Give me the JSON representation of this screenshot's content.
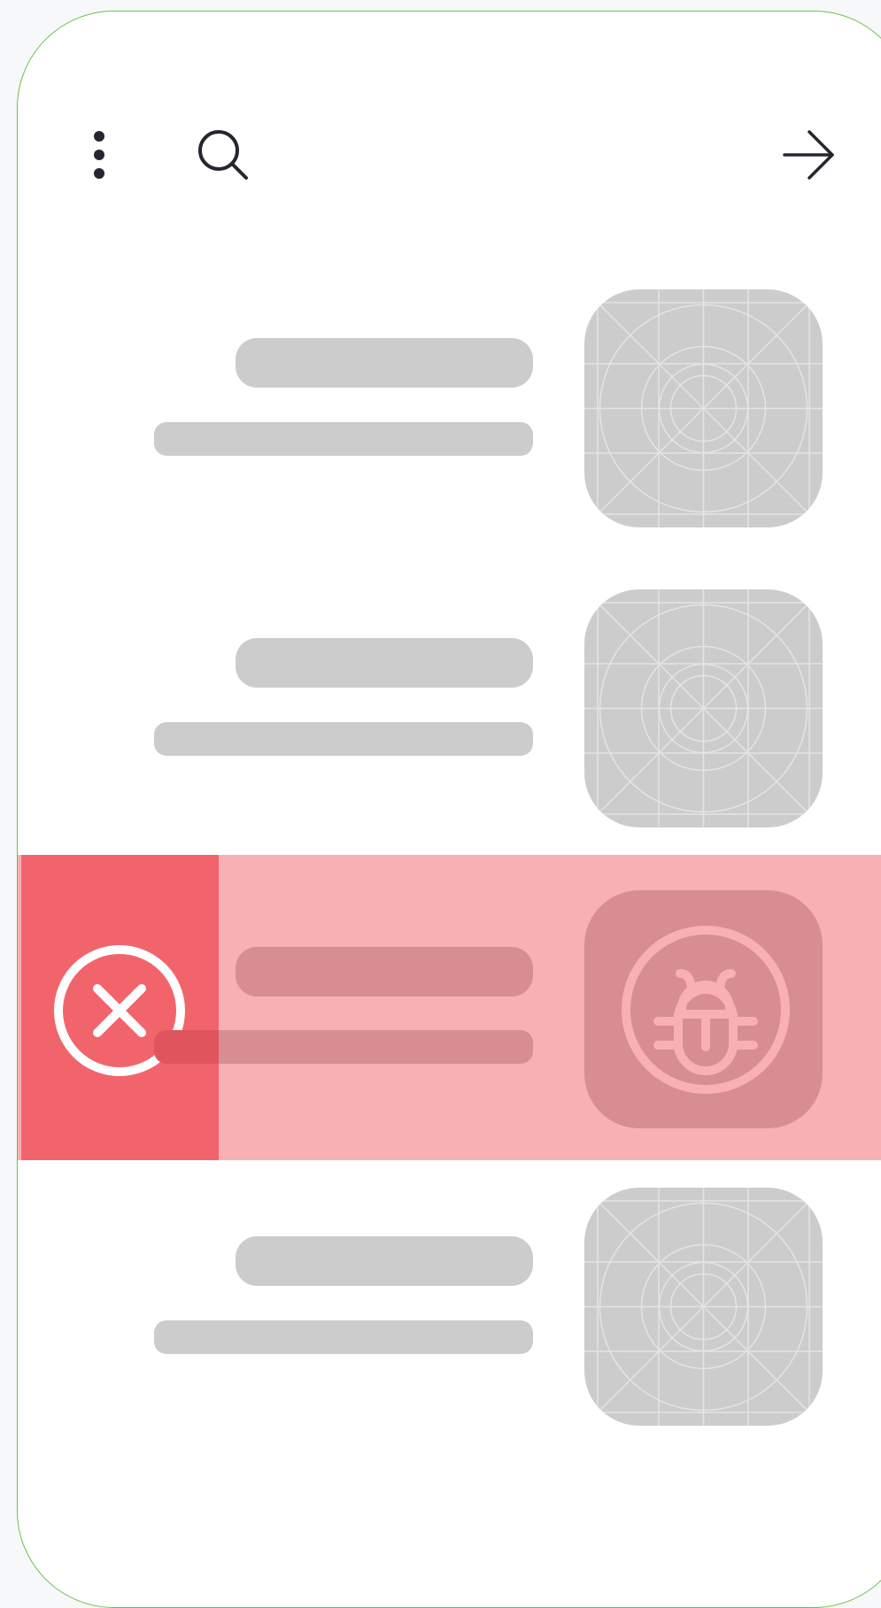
{
  "toolbar": {
    "menu_icon": "more-vertical-icon",
    "search_icon": "search-icon",
    "forward_icon": "arrow-right-icon"
  },
  "list": {
    "items": [
      {
        "thumbnail": "image-placeholder-icon",
        "state": "normal"
      },
      {
        "thumbnail": "image-placeholder-icon",
        "state": "normal"
      },
      {
        "thumbnail": "bug-icon",
        "state": "swiped",
        "action": "delete",
        "action_icon": "close-circle-icon"
      },
      {
        "thumbnail": "image-placeholder-icon",
        "state": "normal"
      }
    ]
  },
  "colors": {
    "frame_border": "#6cc04a",
    "delete_action": "#f2646b",
    "swiped_row": "#f8b0b4",
    "placeholder": "#cccccc",
    "icon": "#262630"
  }
}
